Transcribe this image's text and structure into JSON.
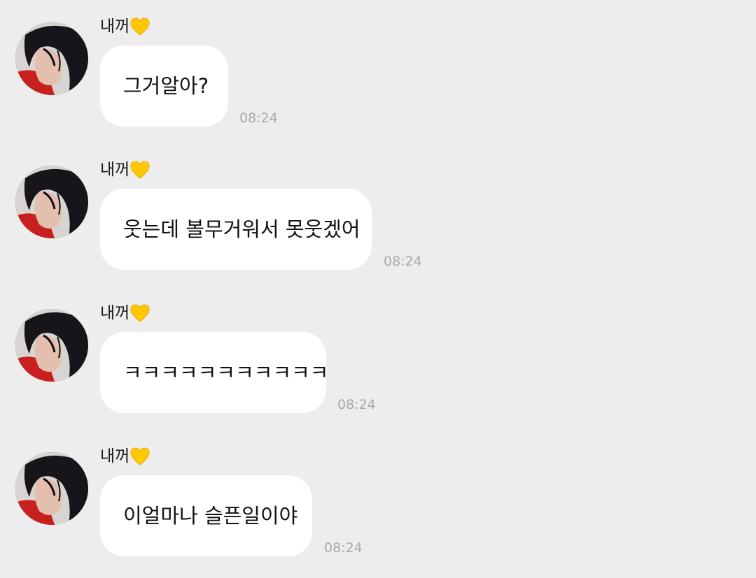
{
  "messages": [
    {
      "sender": "내꺼",
      "text": "그거알아?",
      "time": "08:24"
    },
    {
      "sender": "내꺼",
      "text": "웃는데 볼무거워서 못웃겠어",
      "time": "08:24"
    },
    {
      "sender": "내꺼",
      "text": "ㅋㅋㅋㅋㅋㅋㅋㅋㅋㅋㅋ",
      "time": "08:24"
    },
    {
      "sender": "내꺼",
      "text": "이얼마나 슬픈일이야",
      "time": "08:24"
    }
  ],
  "icons": {
    "sender_badge": "yellow-heart-icon",
    "avatar": "profile-photo"
  },
  "colors": {
    "background": "#ededed",
    "bubble": "#ffffff",
    "heart": "#ffc800",
    "timestamp": "#a9a9a9"
  }
}
